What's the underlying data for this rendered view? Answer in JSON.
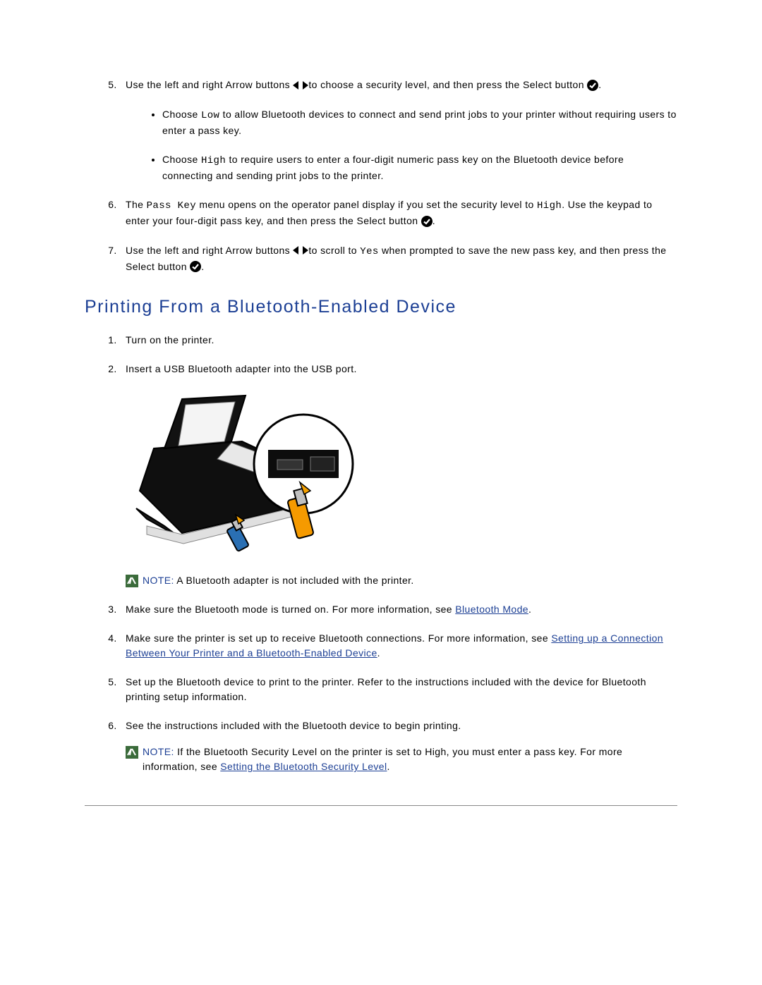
{
  "step5": {
    "pre": "Use the left and right Arrow buttons ",
    "mid": "to choose a security level, and then press the Select button ",
    "end": ".",
    "bullet_low_pre": "Choose ",
    "bullet_low_code": "Low",
    "bullet_low_post": " to allow Bluetooth devices to connect and send print jobs to your printer without requiring users to enter a pass key.",
    "bullet_high_pre": "Choose ",
    "bullet_high_code": "High",
    "bullet_high_post": " to require users to enter a four-digit numeric pass key on the Bluetooth device before connecting and sending print jobs to the printer."
  },
  "step6": {
    "pre": "The ",
    "code1": "Pass Key",
    "mid1": " menu opens on the operator panel display if you set the security level to ",
    "code2": "High",
    "mid2": ". Use the keypad to enter your four-digit pass key, and then press the Select button ",
    "end": "."
  },
  "step7": {
    "pre": "Use the left and right Arrow buttons ",
    "mid1": "to scroll to ",
    "code1": "Yes",
    "mid2": " when prompted to save the new pass key, and then press the Select button ",
    "end": "."
  },
  "heading": "Printing From a Bluetooth-Enabled Device",
  "b_step1": "Turn on the printer.",
  "b_step2": "Insert a USB Bluetooth adapter into the USB port.",
  "note1_label": "NOTE:",
  "note1_text": " A Bluetooth adapter is not included with the printer.",
  "b_step3_pre": "Make sure the Bluetooth mode is turned on. For more information, see ",
  "b_step3_link": "Bluetooth Mode",
  "b_step3_post": ".",
  "b_step4_pre": "Make sure the printer is set up to receive Bluetooth connections. For more information, see ",
  "b_step4_link": "Setting up a Connection Between Your Printer and a Bluetooth-Enabled Device",
  "b_step4_post": ".",
  "b_step5": "Set up the Bluetooth device to print to the printer. Refer to the instructions included with the device for Bluetooth printing setup information.",
  "b_step6": "See the instructions included with the Bluetooth device to begin printing.",
  "note2_label": "NOTE:",
  "note2_text_pre": " If the Bluetooth Security Level on the printer is set to High, you must enter a pass key. For more information, see ",
  "note2_link": "Setting the Bluetooth Security Level",
  "note2_text_post": "."
}
